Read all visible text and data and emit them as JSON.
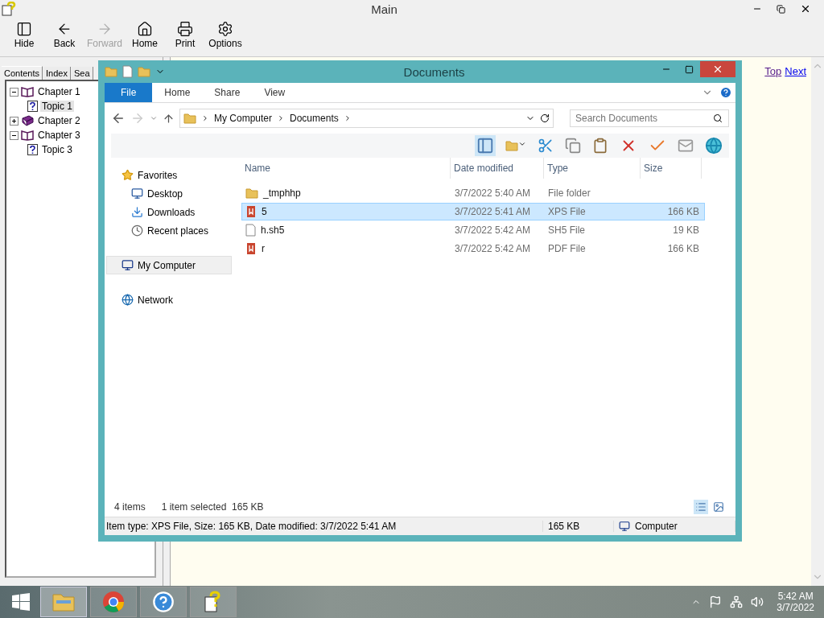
{
  "help_window": {
    "title": "Main",
    "toolbar": [
      {
        "label": "Hide",
        "kind": "hide",
        "disabled": false
      },
      {
        "label": "Back",
        "kind": "back",
        "disabled": false
      },
      {
        "label": "Forward",
        "kind": "forward",
        "disabled": true
      },
      {
        "label": "Home",
        "kind": "home",
        "disabled": false
      },
      {
        "label": "Print",
        "kind": "print",
        "disabled": false
      },
      {
        "label": "Options",
        "kind": "options",
        "disabled": false
      }
    ],
    "tabs": [
      {
        "label": "Contents",
        "selected": true
      },
      {
        "label": "Index",
        "selected": false
      },
      {
        "label": "Sea",
        "selected": false
      }
    ],
    "tree": [
      {
        "label": "Chapter 1",
        "expanded": true,
        "children": [
          {
            "label": "Topic 1",
            "selected": true
          }
        ]
      },
      {
        "label": "Chapter 2",
        "expanded": false
      },
      {
        "label": "Chapter 3",
        "expanded": true,
        "children": [
          {
            "label": "Topic 3",
            "selected": false
          }
        ]
      }
    ],
    "nav_links": [
      "Top",
      "Next"
    ]
  },
  "explorer": {
    "title": "Documents",
    "ribbon_tabs": [
      {
        "label": "File",
        "selected": true
      },
      {
        "label": "Home",
        "selected": false
      },
      {
        "label": "Share",
        "selected": false
      },
      {
        "label": "View",
        "selected": false
      }
    ],
    "breadcrumb": [
      "My Computer",
      "Documents"
    ],
    "search": {
      "placeholder": "Search Documents"
    },
    "nav": [
      {
        "label": "Favorites",
        "kind": "star",
        "selected": false,
        "children": [
          {
            "label": "Desktop",
            "kind": "desktop",
            "selected": false
          },
          {
            "label": "Downloads",
            "kind": "downloads",
            "selected": false
          },
          {
            "label": "Recent places",
            "kind": "recent",
            "selected": false
          }
        ]
      },
      {
        "label": "My Computer",
        "kind": "computer",
        "selected": true
      },
      {
        "label": "Network",
        "kind": "network",
        "selected": false
      }
    ],
    "columns": [
      "Name",
      "Date modified",
      "Type",
      "Size"
    ],
    "rows": [
      {
        "name": "_tmphhp",
        "date": "3/7/2022 5:40 AM",
        "type": "File folder",
        "size": "",
        "kind": "folder",
        "selected": false
      },
      {
        "name": "5",
        "date": "3/7/2022 5:41 AM",
        "type": "XPS File",
        "size": "166 KB",
        "kind": "pdf",
        "selected": true
      },
      {
        "name": "h.sh5",
        "date": "3/7/2022 5:42 AM",
        "type": "SH5 File",
        "size": "19 KB",
        "kind": "file",
        "selected": false
      },
      {
        "name": "r",
        "date": "3/7/2022 5:42 AM",
        "type": "PDF File",
        "size": "166 KB",
        "kind": "pdf",
        "selected": false
      }
    ],
    "item_count": "4 items",
    "selection_info": "1 item selected  165 KB",
    "details": "Item type: XPS File, Size: 165 KB, Date modified: 3/7/2022 5:41 AM",
    "details_size": "165 KB",
    "details_location": "Computer"
  },
  "taskbar": {
    "apps": [
      {
        "kind": "explorer",
        "selected": true
      },
      {
        "kind": "chrome",
        "selected": false
      },
      {
        "kind": "help",
        "selected": false
      },
      {
        "kind": "helpfile",
        "selected": false
      }
    ],
    "time": "5:42 AM",
    "date": "3/7/2022"
  }
}
